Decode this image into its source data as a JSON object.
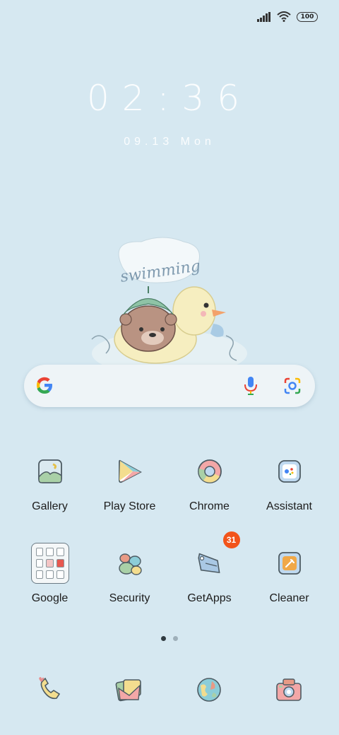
{
  "status": {
    "battery": "100"
  },
  "lockclock": {
    "time": "02:36",
    "date": "09.13 Mon"
  },
  "illustration": {
    "caption": "swimming"
  },
  "apps_row1": [
    {
      "label": "Gallery"
    },
    {
      "label": "Play Store"
    },
    {
      "label": "Chrome"
    },
    {
      "label": "Assistant"
    }
  ],
  "apps_row2": [
    {
      "label": "Google"
    },
    {
      "label": "Security"
    },
    {
      "label": "GetApps",
      "badge": "31"
    },
    {
      "label": "Cleaner"
    }
  ],
  "dock": [
    {
      "icon": "phone-icon"
    },
    {
      "icon": "messages-icon"
    },
    {
      "icon": "browser-icon"
    },
    {
      "icon": "camera-icon"
    }
  ],
  "colors": {
    "background": "#d6e8f1",
    "badge": "#f2541b"
  }
}
